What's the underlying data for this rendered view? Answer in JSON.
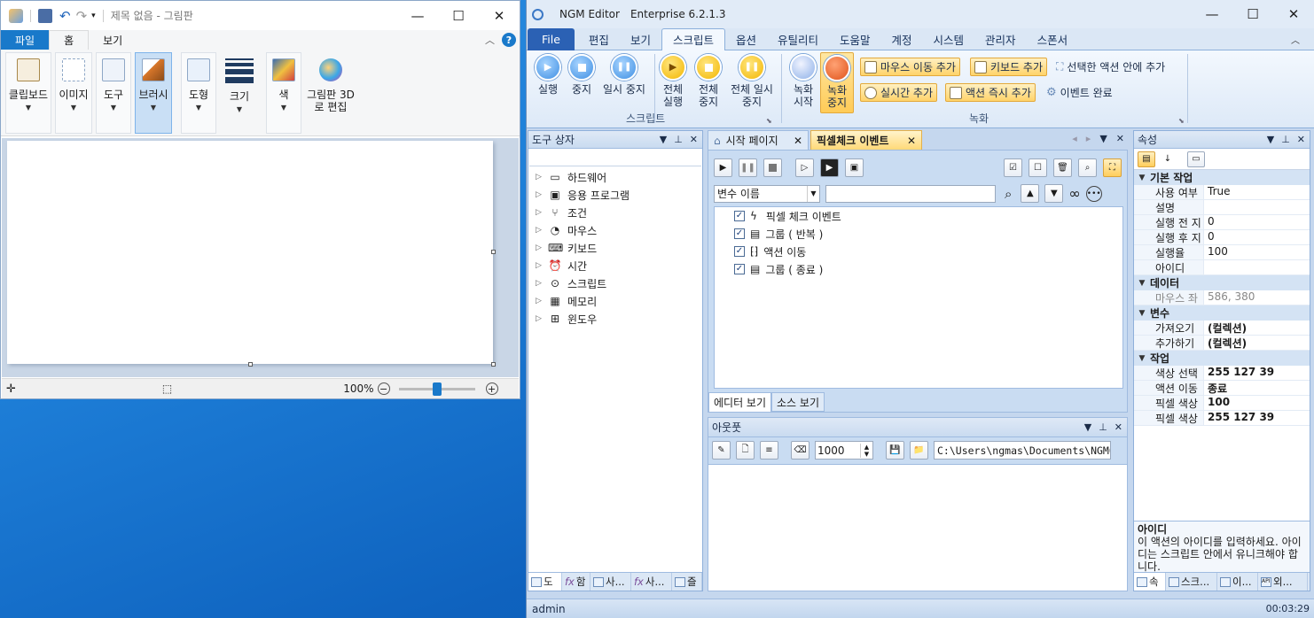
{
  "paint": {
    "title": "제목 없음 - 그림판",
    "tabs": [
      "파일",
      "홈",
      "보기"
    ],
    "groups": [
      {
        "label": "클립보드"
      },
      {
        "label": "이미지"
      },
      {
        "label": "도구"
      },
      {
        "label": "브러시"
      },
      {
        "label": "도형"
      },
      {
        "label": "크기"
      },
      {
        "label": "색"
      },
      {
        "label": "그림판 3D로 편집"
      }
    ],
    "zoom": "100%"
  },
  "ngm": {
    "app_name": "NGM Editor",
    "edition": "Enterprise 6.2.1.3",
    "menu": [
      "File",
      "편집",
      "보기",
      "스크립트",
      "옵션",
      "유틸리티",
      "도움말",
      "계정",
      "시스템",
      "관리자",
      "스폰서"
    ],
    "ribbon": {
      "run": "실행",
      "stop": "중지",
      "pause": "일시 중지",
      "run_all": "전체 실행",
      "stop_all": "전체 중지",
      "pause_all": "전체 일시 중지",
      "script_group": "스크립트",
      "rec_start": "녹화 시작",
      "rec_stop": "녹화 중지",
      "add_mouse_move": "마우스 이동 추가",
      "add_keyboard": "키보드 추가",
      "add_in_selected": "선택한 액션 안에 추가",
      "add_realtime": "실시간 추가",
      "add_action_now": "액션 즉시 추가",
      "event_done": "이벤트 완료",
      "record_group": "녹화"
    },
    "toolbox": {
      "title": "도구 상자",
      "items": [
        "하드웨어",
        "응용 프로그램",
        "조건",
        "마우스",
        "키보드",
        "시간",
        "스크립트",
        "메모리",
        "윈도우"
      ],
      "bottom_tabs": [
        "도",
        "함",
        "사...",
        "사...",
        "즐"
      ]
    },
    "doc_tabs": [
      "시작 페이지",
      "픽셀체크 이벤트"
    ],
    "editor": {
      "var_select": "변수 이름",
      "events": [
        "픽셀 체크 이벤트",
        "그룹 ( 반복 )",
        "액션 이동",
        "그룹 ( 종료 )"
      ],
      "sub_tabs": [
        "에디터 보기",
        "소스 보기"
      ]
    },
    "output": {
      "title": "아웃풋",
      "count": "1000",
      "path": "C:\\Users\\ngmas\\Documents\\NGM6\\"
    },
    "props": {
      "title": "속성",
      "categories": [
        {
          "name": "기본 작업",
          "rows": [
            [
              "사용 여부",
              "True"
            ],
            [
              "설명",
              ""
            ],
            [
              "실행 전 지",
              "0"
            ],
            [
              "실행 후 지",
              "0"
            ],
            [
              "실행율",
              "100"
            ],
            [
              "아이디",
              ""
            ]
          ]
        },
        {
          "name": "데이터",
          "rows": [
            [
              "마우스 좌",
              "586, 380"
            ]
          ]
        },
        {
          "name": "변수",
          "rows": [
            [
              "가져오기",
              "(컬렉션)"
            ],
            [
              "추가하기",
              "(컬렉션)"
            ]
          ]
        },
        {
          "name": "작업",
          "rows": [
            [
              "색상 선택",
              "255 127 39"
            ],
            [
              "액션 이동",
              "종료"
            ],
            [
              "픽셀 색상",
              "100"
            ],
            [
              "픽셀 색상",
              "255 127 39"
            ]
          ]
        }
      ],
      "desc_title": "아이디",
      "desc_text": "이 액션의 아이디를 입력하세요. 아이디는 스크립트 안에서 유니크해야 합니다.",
      "bottom_tabs": [
        "속",
        "스크...",
        "이...",
        "외..."
      ]
    },
    "status": {
      "user": "admin",
      "time": "00:03:29"
    }
  }
}
